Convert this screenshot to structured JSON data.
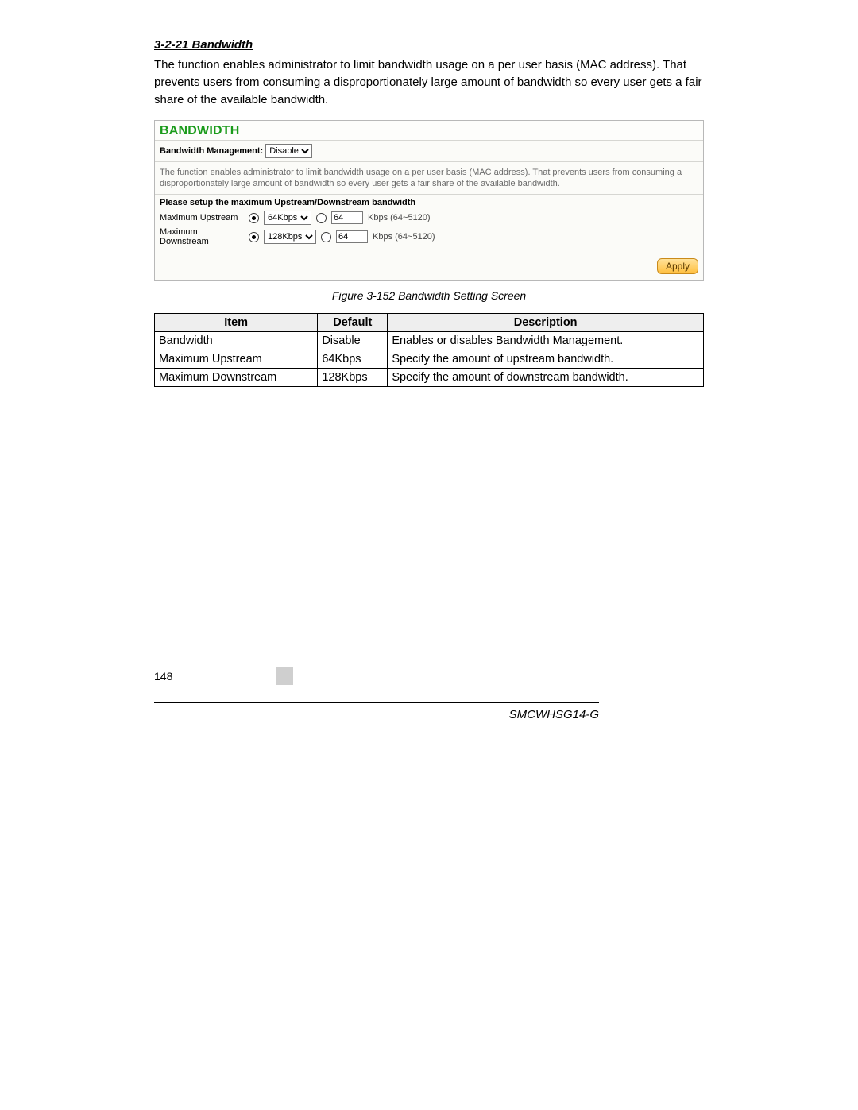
{
  "section": {
    "number_title": "3-2-21 Bandwidth",
    "intro": "The function enables administrator to limit bandwidth usage on a per user basis (MAC address). That prevents users from consuming a disproportionately large amount of bandwidth so every user gets a fair share of the available bandwidth."
  },
  "figure": {
    "panel_title": "BANDWIDTH",
    "mgmt_label": "Bandwidth Management:",
    "mgmt_value": "Disable",
    "long_desc": "The function enables administrator to limit bandwidth usage on a per user basis (MAC address). That prevents users from consuming a disproportionately large amount of bandwidth so every user gets a fair share of the available bandwidth.",
    "setup_heading": "Please setup the maximum Upstream/Downstream bandwidth",
    "rows": {
      "up": {
        "label": "Maximum Upstream",
        "select_value": "64Kbps",
        "text_value": "64",
        "hint": "Kbps (64~5120)"
      },
      "down": {
        "label": "Maximum Downstream",
        "select_value": "128Kbps",
        "text_value": "64",
        "hint": "Kbps (64~5120)"
      }
    },
    "apply_label": "Apply",
    "caption": "Figure 3-152 Bandwidth Setting Screen"
  },
  "table": {
    "headers": {
      "item": "Item",
      "def": "Default",
      "desc": "Description"
    },
    "rows": [
      {
        "item": "Bandwidth",
        "def": "Disable",
        "desc": "Enables or disables Bandwidth Management."
      },
      {
        "item": "Maximum Upstream",
        "def": "64Kbps",
        "desc": "Specify the amount of upstream bandwidth."
      },
      {
        "item": "Maximum Downstream",
        "def": "128Kbps",
        "desc": "Specify the amount of downstream bandwidth."
      }
    ]
  },
  "footer": {
    "page": "148",
    "model": "SMCWHSG14-G"
  }
}
